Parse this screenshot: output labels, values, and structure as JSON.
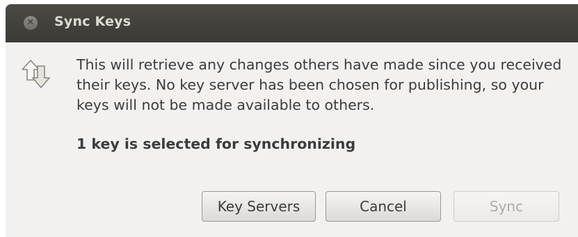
{
  "window": {
    "title": "Sync Keys",
    "close_icon": "close-icon"
  },
  "body": {
    "icon": "sync-arrows-icon",
    "message": "This will retrieve any changes others have made since you received their keys. No key server has been chosen for publishing, so your keys will not be made available to others.",
    "status": "1 key is selected for synchronizing"
  },
  "buttons": {
    "key_servers": "Key Servers",
    "cancel": "Cancel",
    "sync": "Sync",
    "sync_enabled": false
  }
}
